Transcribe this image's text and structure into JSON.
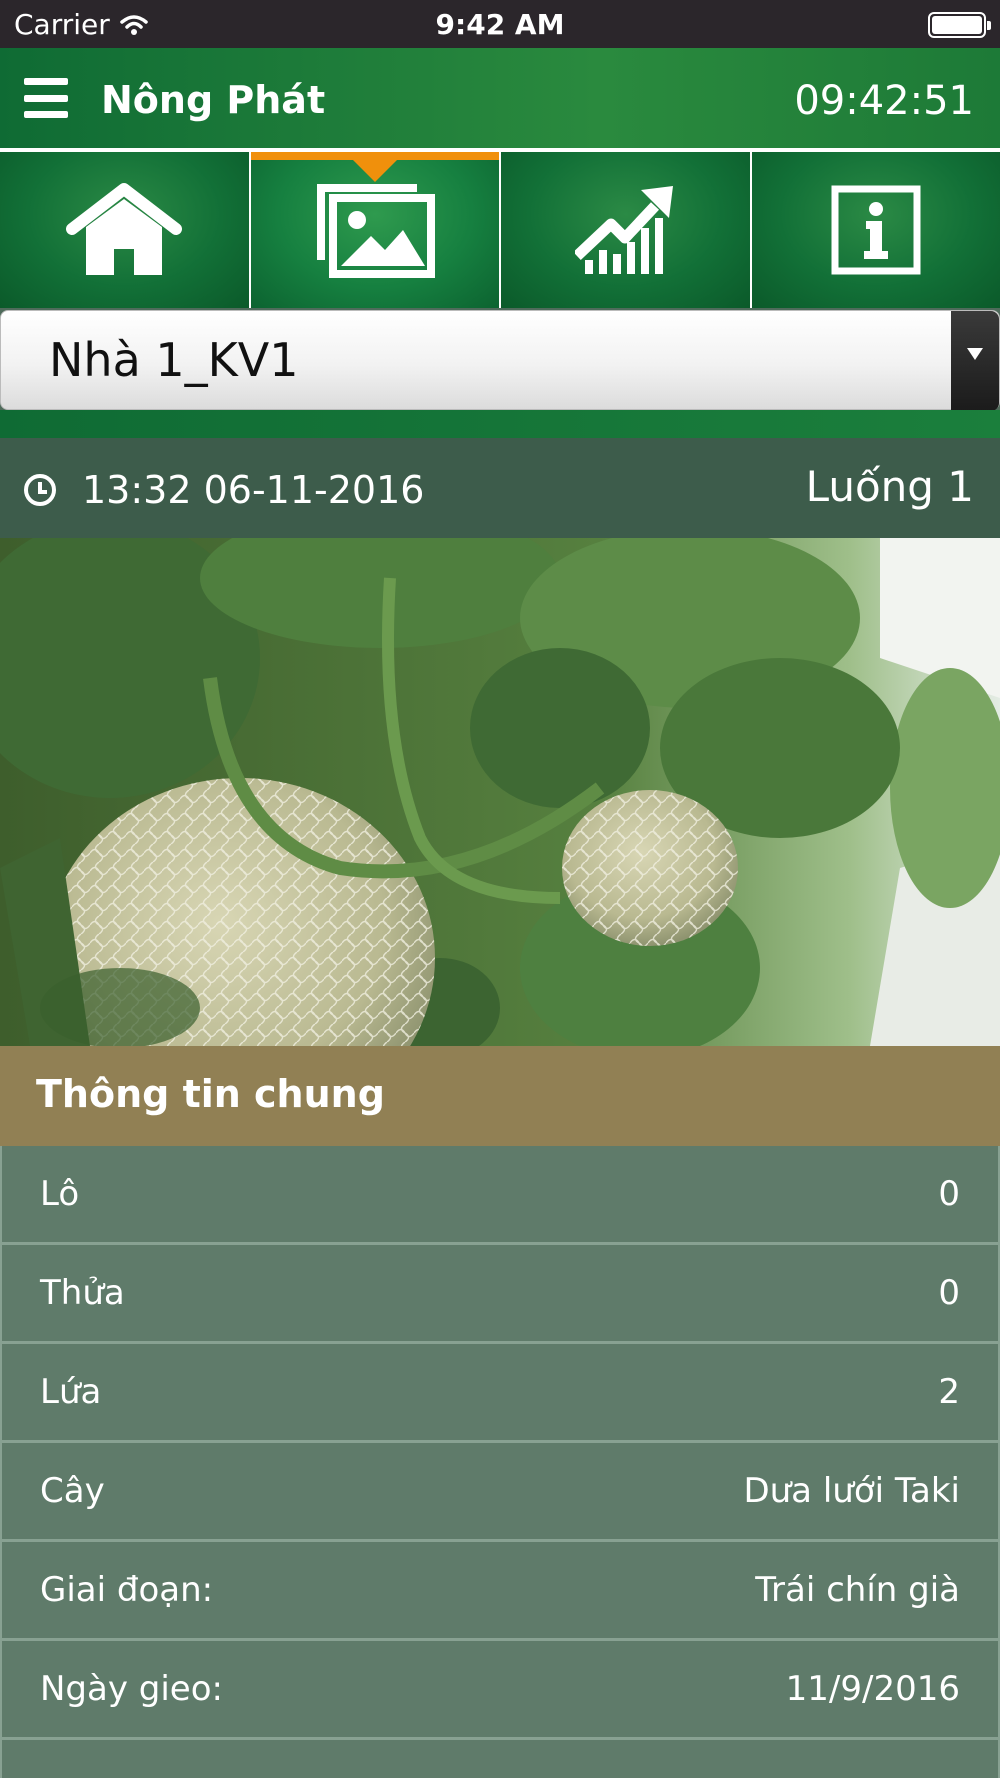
{
  "status_bar": {
    "carrier": "Carrier",
    "time": "9:42 AM"
  },
  "header": {
    "title": "Nông Phát",
    "clock": "09:42:51"
  },
  "tabs": [
    {
      "name": "home-icon",
      "active": false
    },
    {
      "name": "gallery-icon",
      "active": true
    },
    {
      "name": "chart-icon",
      "active": false
    },
    {
      "name": "info-icon",
      "active": false
    }
  ],
  "selector": {
    "value": "Nhà 1_KV1"
  },
  "capture": {
    "datetime": "13:32 06-11-2016",
    "line": "Luống 1"
  },
  "section": {
    "title": "Thông tin chung"
  },
  "details": [
    {
      "label": "Lô",
      "value": "0"
    },
    {
      "label": "Thửa",
      "value": "0"
    },
    {
      "label": "Lứa",
      "value": "2"
    },
    {
      "label": "Cây",
      "value": "Dưa lưới Taki"
    },
    {
      "label": "Giai đoạn:",
      "value": "Trái chín già"
    },
    {
      "label": "Ngày gieo:",
      "value": "11/9/2016"
    },
    {
      "label": "",
      "value": ""
    }
  ],
  "colors": {
    "brand_green": "#127037",
    "accent_orange": "#f0900c",
    "section_header": "#918054",
    "row_bg": "#5f7b6a"
  }
}
